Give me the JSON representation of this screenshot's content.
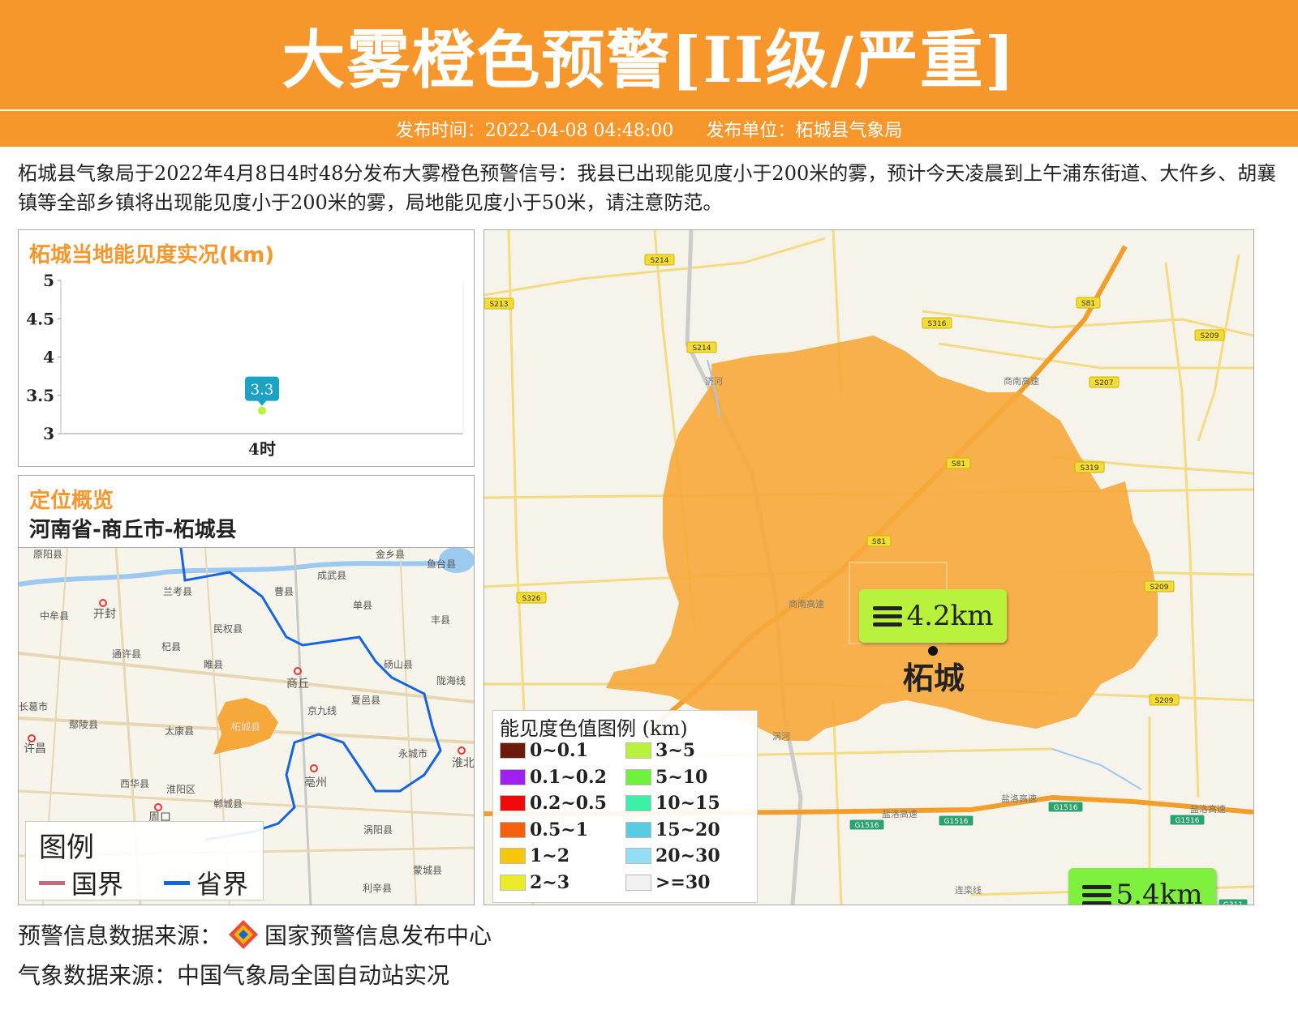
{
  "header": {
    "title": "大雾橙色预警[II级/严重]"
  },
  "subbar": {
    "time": "发布时间：2022-04-08 04:48:00",
    "unit": "发布单位：柘城县气象局"
  },
  "description": "柘城县气象局于2022年4月8日4时48分发布大雾橙色预警信号：我县已出现能见度小于200米的雾，预计今天凌晨到上午浦东街道、大仵乡、胡襄镇等全部乡镇将出现能见度小于200米的雾，局地能见度小于50米，请注意防范。",
  "vis_panel": {
    "title": "柘城当地能见度实况(km)"
  },
  "chart_data": {
    "type": "scatter",
    "title": "柘城当地能见度实况(km)",
    "categories": [
      "4时"
    ],
    "values": [
      3.3
    ],
    "data_labels": [
      "3.3"
    ],
    "yticks": [
      "5",
      "4.5",
      "4",
      "3.5",
      "3"
    ],
    "ylim": [
      3,
      5
    ],
    "grid": false,
    "point_color": "#b9f23d",
    "label_color": "#1ba3c6"
  },
  "location_panel": {
    "title": "定位概览",
    "path": "河南省-商丘市-柘城县"
  },
  "overview_map": {
    "labels": [
      "原阳县",
      "金乡县",
      "鱼台县",
      "兰考县",
      "成武县",
      "中牟县",
      "开封",
      "曹县",
      "单县",
      "民权县",
      "丰县",
      "杞县",
      "通许县",
      "砀山县",
      "睢县",
      "商丘",
      "陇海线",
      "长葛市",
      "夏邑县",
      "鄢陵县",
      "太康县",
      "柘城县",
      "许昌",
      "永城市",
      "淮北",
      "西华县",
      "淮阳区",
      "亳州",
      "郸城县",
      "周口",
      "涡阳县",
      "蒙城县",
      "利辛县",
      "京九线"
    ],
    "legend_title": "图例",
    "legend_items": [
      {
        "label": "国界",
        "color": "#c56c7a"
      },
      {
        "label": "省界",
        "color": "#1565e0"
      }
    ],
    "highlight_color": "#f7a83a"
  },
  "main_map": {
    "road_labels": [
      "S214",
      "S213",
      "S214",
      "S316",
      "S81",
      "S209",
      "S207",
      "S81",
      "S319",
      "S81",
      "S326",
      "S209",
      "S209",
      "G1516",
      "G1516",
      "G1516",
      "G1516",
      "G311"
    ],
    "text_labels": [
      "济河",
      "商南高速",
      "商南高速",
      "盐洛高速",
      "盐洛高速",
      "盐洛高速",
      "连栾线",
      "涡河"
    ],
    "city": "柘城",
    "vis_points": [
      {
        "value": "4.2km",
        "color": "#b9f23d"
      },
      {
        "value": "5.4km",
        "color": "#7ef03d"
      }
    ],
    "area_color": "#f7a83a"
  },
  "color_legend": {
    "title": "能见度色值图例 (km)",
    "items": [
      {
        "label": "0~0.1",
        "color": "#6b1a0b"
      },
      {
        "label": "3~5",
        "color": "#b9f23d"
      },
      {
        "label": "0.1~0.2",
        "color": "#a020f0"
      },
      {
        "label": "5~10",
        "color": "#6ff03d"
      },
      {
        "label": "0.2~0.5",
        "color": "#ee0a0a"
      },
      {
        "label": "10~15",
        "color": "#3df0a7"
      },
      {
        "label": "0.5~1",
        "color": "#f5600c"
      },
      {
        "label": "15~20",
        "color": "#5bcbe0"
      },
      {
        "label": "1~2",
        "color": "#f7c60c"
      },
      {
        "label": "20~30",
        "color": "#93def5"
      },
      {
        "label": "2~3",
        "color": "#eaeb2b"
      },
      {
        "label": ">=30",
        "color": "#f2f2f2"
      }
    ]
  },
  "footer": {
    "warning_source": "预警信息数据来源：",
    "warning_center": "国家预警信息发布中心",
    "weather_source": "气象数据来源：中国气象局全国自动站实况"
  }
}
